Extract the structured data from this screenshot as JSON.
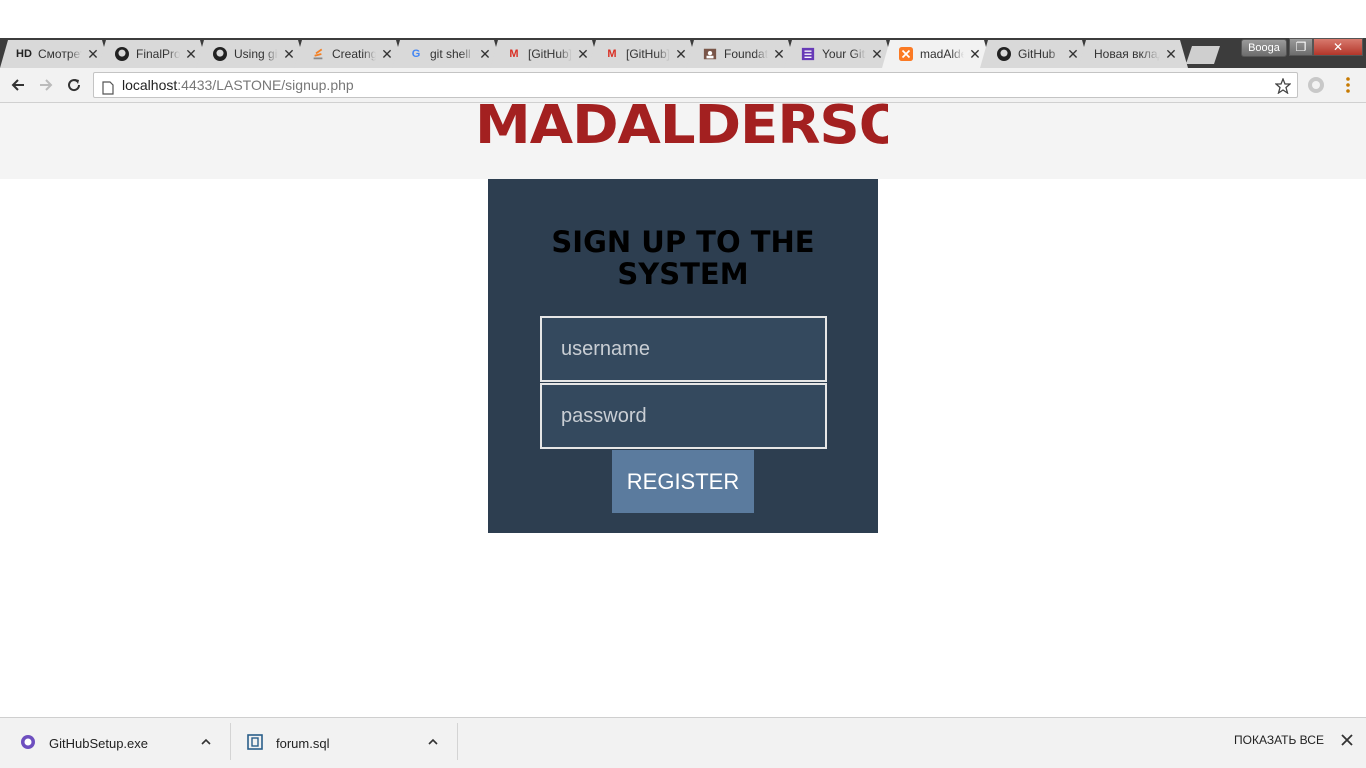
{
  "browser": {
    "tabs": [
      {
        "title": "Смотреть",
        "favicon": "HD"
      },
      {
        "title": "FinalProject",
        "favicon": "github-icon"
      },
      {
        "title": "Using git",
        "favicon": "github-icon"
      },
      {
        "title": "Creating",
        "favicon": "stackoverflow-icon"
      },
      {
        "title": "git shell",
        "favicon": "google-icon"
      },
      {
        "title": "[GitHub]",
        "favicon": "gmail-icon"
      },
      {
        "title": "[GitHub]",
        "favicon": "gmail-icon"
      },
      {
        "title": "Foundation",
        "favicon": "contact-icon"
      },
      {
        "title": "Your GitHub",
        "favicon": "form-icon"
      },
      {
        "title": "madAlderson",
        "favicon": "xampp-icon",
        "active": true
      },
      {
        "title": "GitHub",
        "favicon": "github-icon"
      },
      {
        "title": "Новая вкладка",
        "favicon": ""
      }
    ],
    "profile_name": "Booga",
    "address": {
      "host": "localhost",
      "rest": ":4433/LASTONE/signup.php"
    }
  },
  "page": {
    "logo": "MADALDERSON",
    "form_title": "SIGN UP TO THE SYSTEM",
    "username_placeholder": "username",
    "password_placeholder": "password",
    "register_label": "REGISTER"
  },
  "downloads": {
    "items": [
      {
        "name": "GitHubSetup.exe"
      },
      {
        "name": "forum.sql"
      }
    ],
    "show_all": "ПОКАЗАТЬ ВСЕ"
  },
  "colors": {
    "logo": "#a32020",
    "panel": "#2d3e50",
    "field": "#34495e",
    "button": "#5b7b9e"
  }
}
